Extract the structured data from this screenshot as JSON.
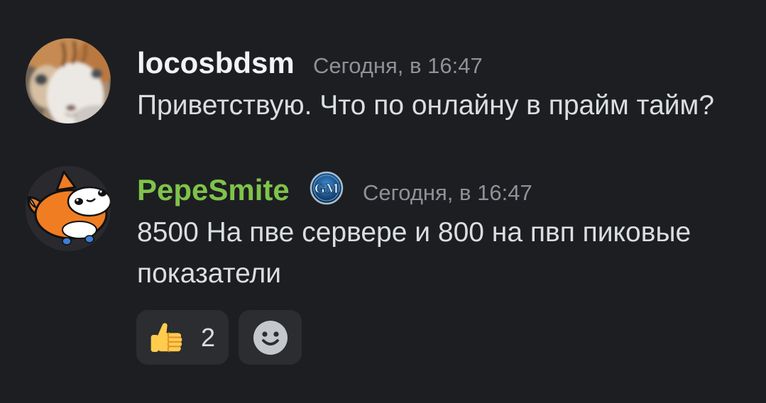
{
  "colors": {
    "background": "#1d1e22",
    "message_text": "#dbdee1",
    "timestamp": "#8e9297",
    "reaction_background": "#2b2d31"
  },
  "messages": [
    {
      "author": {
        "name": "locosbdsm",
        "color": "#f2f3f5",
        "avatar_icon": "cat-photo-avatar"
      },
      "timestamp": "Сегодня, в 16:47",
      "lines": [
        "Приветствую. Что по онлайну в прайм тайм?"
      ]
    },
    {
      "author": {
        "name": "PepeSmite",
        "color": "#7fc34a",
        "avatar_icon": "orange-fox-avatar",
        "badge": {
          "icon": "gm-badge-icon",
          "text": "GM"
        }
      },
      "timestamp": "Сегодня, в 16:47",
      "lines": [
        "8500 На пве сервере и 800 на пвп пиковые",
        "показатели"
      ],
      "reactions": [
        {
          "icon": "thumbs-up-icon",
          "count": "2"
        }
      ],
      "add_reaction_icon": "add-reaction-icon"
    }
  ]
}
